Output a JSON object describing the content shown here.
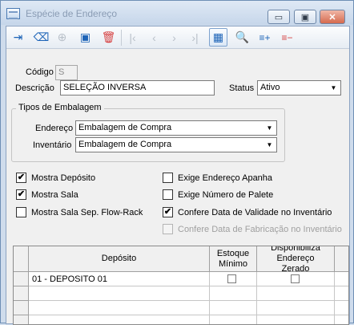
{
  "window": {
    "title": "Espécie de Endereço",
    "minimize_glyph": "▭",
    "maximize_glyph": "▣",
    "close_glyph": "✕"
  },
  "toolbar": {
    "buttons": [
      {
        "name": "exit-icon",
        "glyph": "⇥",
        "state": "enabled"
      },
      {
        "name": "eraser-icon",
        "glyph": "⌫",
        "state": "enabled"
      },
      {
        "name": "add-icon",
        "glyph": "⊕",
        "state": "disabled"
      },
      {
        "name": "save-icon",
        "glyph": "▣",
        "state": "enabled"
      },
      {
        "name": "delete-icon",
        "glyph": "🗑",
        "state": "enabled-red"
      },
      {
        "name": "first-record-icon",
        "glyph": "|‹",
        "state": "disabled"
      },
      {
        "name": "previous-record-icon",
        "glyph": "‹",
        "state": "disabled"
      },
      {
        "name": "next-record-icon",
        "glyph": "›",
        "state": "disabled"
      },
      {
        "name": "last-record-icon",
        "glyph": "›|",
        "state": "disabled"
      },
      {
        "name": "grid-view-icon",
        "glyph": "▦",
        "state": "selected"
      },
      {
        "name": "search-icon",
        "glyph": "🔍",
        "state": "disabled"
      },
      {
        "name": "add-row-icon",
        "glyph": "≡+",
        "state": "enabled"
      },
      {
        "name": "remove-row-icon",
        "glyph": "≡−",
        "state": "enabled-red"
      }
    ]
  },
  "form": {
    "codigo_label": "Código",
    "codigo_value": "S",
    "descricao_label": "Descrição",
    "descricao_value": "SELEÇÃO INVERSA",
    "status_label": "Status",
    "status_value": "Ativo"
  },
  "tipos": {
    "group_title": "Tipos de Embalagem",
    "endereco_label": "Endereço",
    "endereco_value": "Embalagem de Compra",
    "inventario_label": "Inventário",
    "inventario_value": "Embalagem de Compra"
  },
  "options": {
    "mostra_deposito": {
      "label": "Mostra Depósito",
      "checked": true
    },
    "mostra_sala": {
      "label": "Mostra Sala",
      "checked": true
    },
    "mostra_sala_sep": {
      "label": "Mostra Sala Sep. Flow-Rack",
      "checked": false
    },
    "exige_endereco_apanha": {
      "label": "Exige Endereço Apanha",
      "checked": false
    },
    "exige_numero_palete": {
      "label": "Exige Número de Palete",
      "checked": false
    },
    "confere_data_validade": {
      "label": "Confere Data de Validade no Inventário",
      "checked": true
    },
    "confere_data_fabricacao": {
      "label": "Confere Data de Fabricação no Inventário",
      "checked": false,
      "disabled": true
    }
  },
  "grid": {
    "columns": {
      "deposito": "Depósito",
      "estoque_minimo": "Estoque Mínimo",
      "disponibiliza": "Disponibiliza Endereço Zerado"
    },
    "rows": [
      {
        "deposito": "01 - DEPOSITO 01",
        "estoque_minimo": false,
        "disponibiliza": false
      }
    ]
  },
  "icons": {
    "check": "✔",
    "dropdown": "▼"
  }
}
